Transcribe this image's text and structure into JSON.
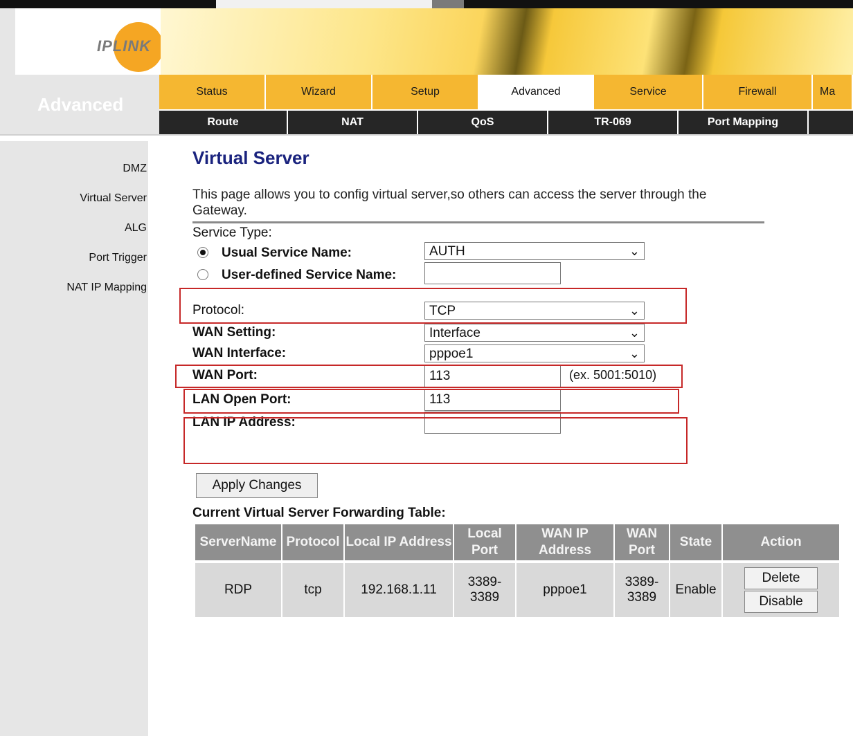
{
  "logo": {
    "text": "IPLINK"
  },
  "sidebar": {
    "section_title": "Advanced",
    "items": [
      {
        "label": "DMZ"
      },
      {
        "label": "Virtual Server"
      },
      {
        "label": "ALG"
      },
      {
        "label": "Port Trigger"
      },
      {
        "label": "NAT IP Mapping"
      }
    ]
  },
  "nav": {
    "tabs": [
      {
        "label": "Status"
      },
      {
        "label": "Wizard"
      },
      {
        "label": "Setup"
      },
      {
        "label": "Advanced",
        "active": true
      },
      {
        "label": "Service"
      },
      {
        "label": "Firewall"
      },
      {
        "label": "Ma"
      }
    ],
    "subtabs": [
      {
        "label": "Route"
      },
      {
        "label": "NAT"
      },
      {
        "label": "QoS"
      },
      {
        "label": "TR-069"
      },
      {
        "label": "Port Mapping"
      }
    ]
  },
  "page": {
    "title": "Virtual Server",
    "description": "This page allows you to config virtual server,so others can access the server through the Gateway."
  },
  "form": {
    "service_type_label": "Service Type:",
    "usual_service_label": "Usual Service Name:",
    "usual_service_value": "AUTH",
    "usual_service_checked": true,
    "user_defined_label": "User-defined Service Name:",
    "user_defined_value": "",
    "protocol_label": "Protocol:",
    "protocol_value": "TCP",
    "wan_setting_label": "WAN Setting:",
    "wan_setting_value": "Interface",
    "wan_interface_label": "WAN Interface:",
    "wan_interface_value": "pppoe1",
    "wan_port_label": "WAN Port:",
    "wan_port_value": "113",
    "wan_port_hint": "(ex. 5001:5010)",
    "lan_open_port_label": "LAN Open Port:",
    "lan_open_port_value": "113",
    "lan_ip_label": "LAN IP Address:",
    "lan_ip_value": "",
    "apply_label": "Apply Changes"
  },
  "table": {
    "title": "Current Virtual Server Forwarding Table:",
    "headers": [
      "ServerName",
      "Protocol",
      "Local IP Address",
      "Local Port",
      "WAN IP Address",
      "WAN Port",
      "State",
      "Action"
    ],
    "rows": [
      {
        "server_name": "RDP",
        "protocol": "tcp",
        "local_ip": "192.168.1.11",
        "local_port": "3389-3389",
        "wan_ip": "pppoe1",
        "wan_port": "3389-3389",
        "state": "Enable",
        "delete_label": "Delete",
        "disable_label": "Disable"
      }
    ]
  },
  "colors": {
    "nav_tab": "#f5b731",
    "subnav": "#262626",
    "title": "#1a237e",
    "highlight_box": "#c62828",
    "table_header": "#8f8f8f",
    "table_cell": "#d9d9d9"
  }
}
